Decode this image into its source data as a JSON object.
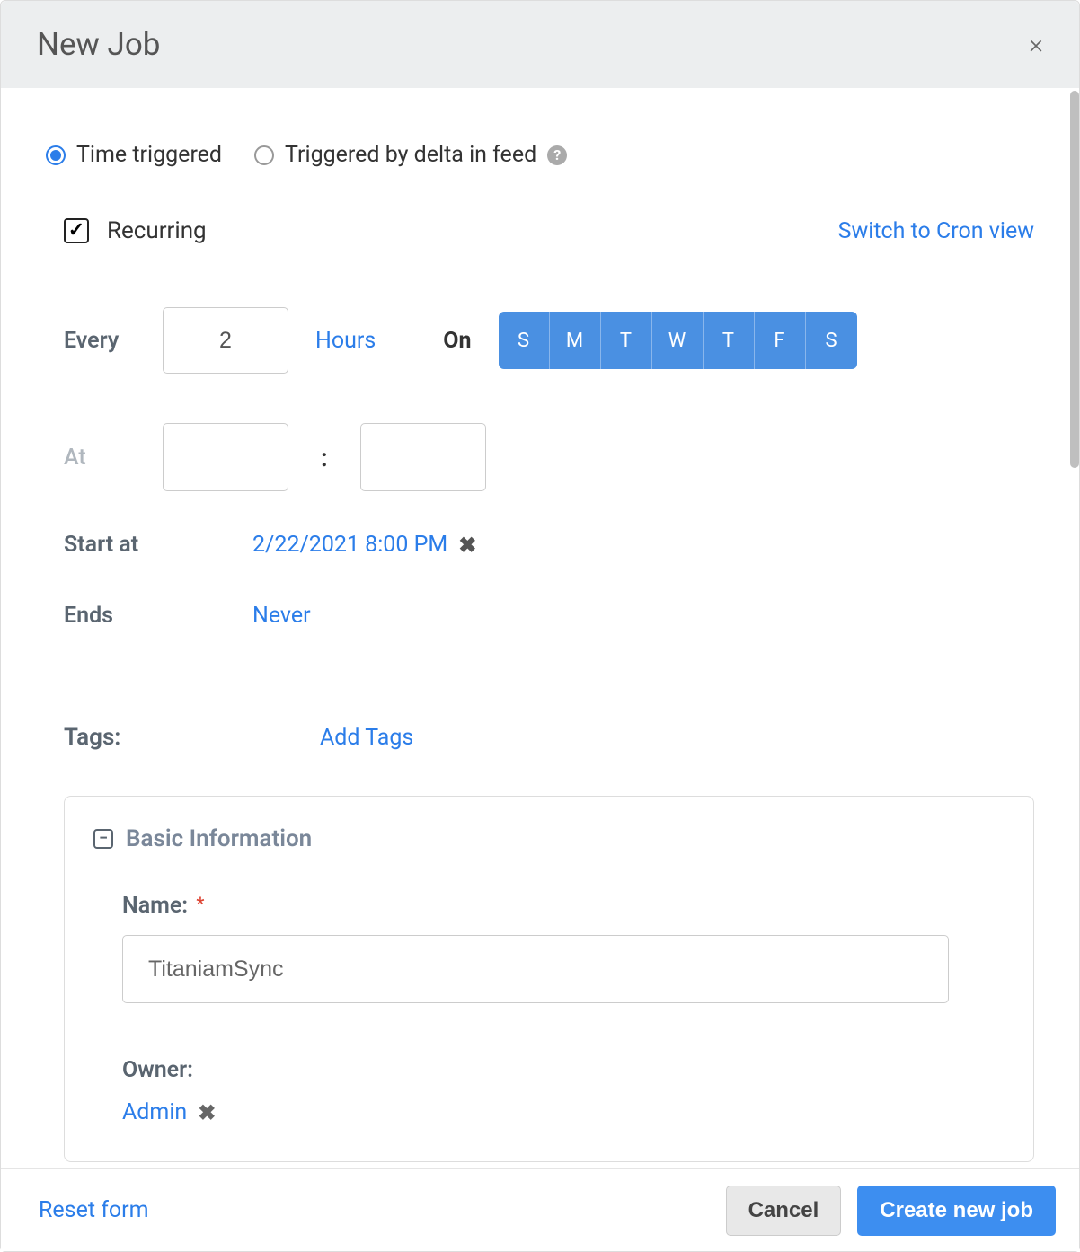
{
  "modal": {
    "title": "New Job",
    "close": "×"
  },
  "trigger": {
    "time_label": "Time triggered",
    "delta_label": "Triggered by delta in feed",
    "help": "?"
  },
  "recurring": {
    "label": "Recurring",
    "checked": true,
    "switch_link": "Switch to Cron view"
  },
  "every": {
    "label": "Every",
    "value": "2",
    "unit": "Hours",
    "on_label": "On",
    "days": [
      "S",
      "M",
      "T",
      "W",
      "T",
      "F",
      "S"
    ]
  },
  "at": {
    "label": "At",
    "hour": "",
    "minute": "",
    "sep": ":"
  },
  "start": {
    "label": "Start at",
    "value": "2/22/2021 8:00 PM",
    "clear": "✖"
  },
  "ends": {
    "label": "Ends",
    "value": "Never"
  },
  "tags": {
    "label": "Tags:",
    "link": "Add Tags"
  },
  "basic": {
    "title": "Basic Information",
    "collapse": "−",
    "name_label": "Name:",
    "name_value": "TitaniamSync",
    "required": "*",
    "owner_label": "Owner:",
    "owner_value": "Admin",
    "owner_clear": "✖"
  },
  "footer": {
    "reset": "Reset form",
    "cancel": "Cancel",
    "create": "Create new job"
  }
}
